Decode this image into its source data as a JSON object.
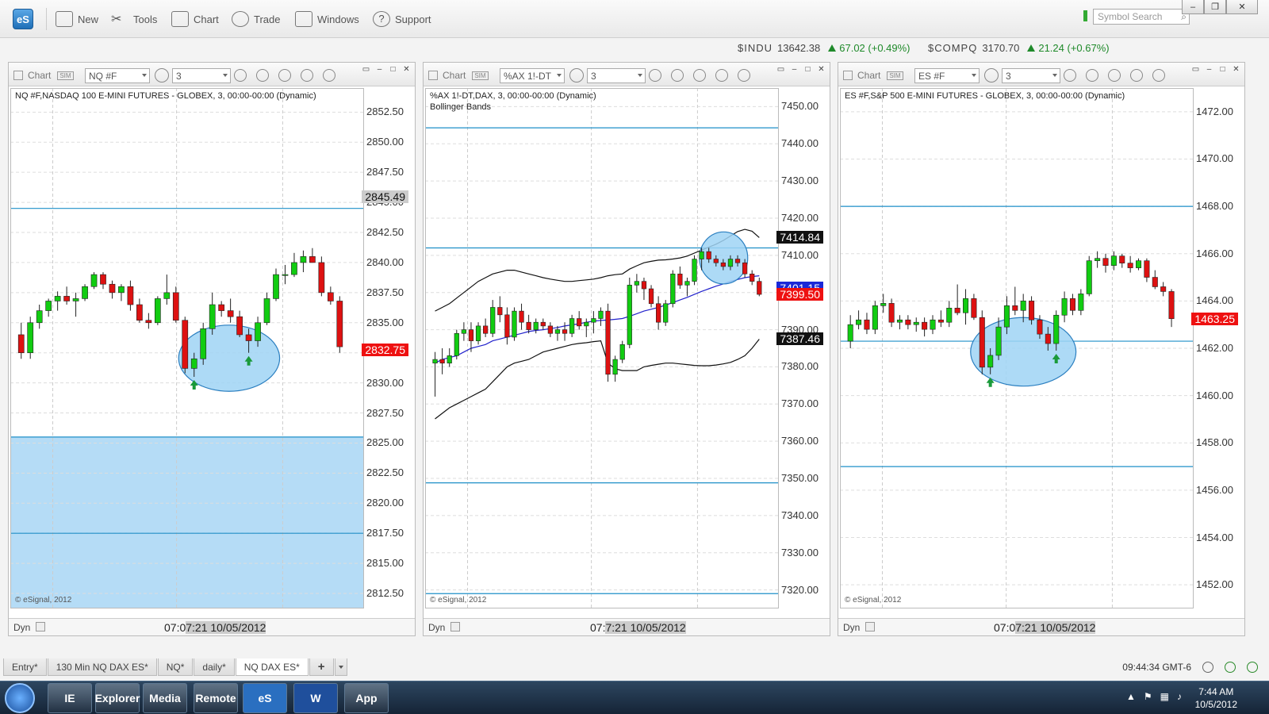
{
  "app": {
    "logo": "eS",
    "toolbar": [
      {
        "label": "New",
        "icon": "new-window-icon"
      },
      {
        "label": "Tools",
        "icon": "tools-icon"
      },
      {
        "label": "Chart",
        "icon": "chart-icon"
      },
      {
        "label": "Trade",
        "icon": "trade-icon"
      },
      {
        "label": "Windows",
        "icon": "windows-icon"
      },
      {
        "label": "Support",
        "icon": "help-icon"
      }
    ],
    "symbol_search_placeholder": "Symbol Search",
    "win_min": "–",
    "win_max": "❐",
    "win_close": "✕"
  },
  "ticker": [
    {
      "symbol": "$INDU",
      "value": "13642.38",
      "change": "67.02 (+0.49%)"
    },
    {
      "symbol": "$COMPQ",
      "value": "3170.70",
      "change": "21.24 (+0.67%)"
    }
  ],
  "panels": [
    {
      "title": "Chart",
      "symbol": "NQ #F",
      "interval": "3",
      "info": "NQ #F,NASDAQ 100 E-MINI FUTURES - GLOBEX, 3, 00:00-00:00 (Dynamic)",
      "info2": "",
      "copyright": "© eSignal, 2012",
      "dyn": "Dyn",
      "time_prefix": "07:0",
      "time_label": "7:21 10/05/2012",
      "ticks": [
        "2852.50",
        "2850.00",
        "2847.50",
        "2845.00",
        "2842.50",
        "2840.00",
        "2837.50",
        "2835.00",
        "2832.50",
        "2830.00",
        "2827.50",
        "2825.00",
        "2822.50",
        "2820.00",
        "2817.50",
        "2815.00",
        "2812.50"
      ],
      "price_tags": [
        {
          "label": "2845.49",
          "value": 2845.49,
          "style": "gray"
        },
        {
          "label": "2832.75",
          "value": 2832.75,
          "style": "red"
        }
      ]
    },
    {
      "title": "Chart",
      "symbol": "%AX 1!-DT",
      "interval": "3",
      "info": "%AX 1!-DT,DAX, 3, 00:00-00:00 (Dynamic)",
      "info2": "Bollinger Bands",
      "copyright": "© eSignal, 2012",
      "dyn": "Dyn",
      "time_prefix": "07:",
      "time_label": "7:21 10/05/2012",
      "ticks": [
        "7450.00",
        "7440.00",
        "7430.00",
        "7420.00",
        "7410.00",
        "7400.00",
        "7390.00",
        "7380.00",
        "7370.00",
        "7360.00",
        "7350.00",
        "7340.00",
        "7330.00",
        "7320.00"
      ],
      "price_tags": [
        {
          "label": "7414.84",
          "value": 7414.84,
          "style": "black"
        },
        {
          "label": "7401.15",
          "value": 7401.15,
          "style": "blue"
        },
        {
          "label": "7399.50",
          "value": 7399.5,
          "style": "red"
        },
        {
          "label": "7387.46",
          "value": 7387.46,
          "style": "black"
        }
      ]
    },
    {
      "title": "Chart",
      "symbol": "ES #F",
      "interval": "3",
      "info": "ES #F,S&P 500 E-MINI FUTURES - GLOBEX, 3, 00:00-00:00 (Dynamic)",
      "info2": "",
      "copyright": "© eSignal, 2012",
      "dyn": "Dyn",
      "time_prefix": "07:0",
      "time_label": "7:21 10/05/2012",
      "ticks": [
        "1472.00",
        "1470.00",
        "1468.00",
        "1466.00",
        "1464.00",
        "1462.00",
        "1460.00",
        "1458.00",
        "1456.00",
        "1454.00",
        "1452.00"
      ],
      "price_tags": [
        {
          "label": "1463.25",
          "value": 1463.25,
          "style": "red"
        }
      ]
    }
  ],
  "tabs": [
    {
      "label": "Entry*",
      "active": false
    },
    {
      "label": "130 Min NQ DAX ES*",
      "active": false
    },
    {
      "label": "NQ*",
      "active": false
    },
    {
      "label": "daily*",
      "active": false
    },
    {
      "label": "NQ DAX ES*",
      "active": true
    }
  ],
  "add_tab": "+",
  "status": {
    "time": "09:44:34 GMT-6"
  },
  "taskbar": {
    "clock_time": "7:44 AM",
    "clock_date": "10/5/2012",
    "apps": [
      "IE",
      "Explorer",
      "Media",
      "Remote",
      "eS",
      "W",
      "App"
    ]
  },
  "colors": {
    "bull": "#11cc11",
    "bear": "#dd1111",
    "level": "#1e8fc8",
    "zone": "#b5dcf6",
    "ellipse": "#9fd4f5"
  },
  "chart_data": [
    {
      "type": "candlestick",
      "symbol": "NQ #F",
      "ylim": [
        2811.25,
        2854.5
      ],
      "levels": [
        2844.5,
        2825.5,
        2817.5
      ],
      "zone": [
        2811.25,
        2825.5
      ],
      "last": 2832.75,
      "ohlc": [
        [
          2834,
          2835,
          2832,
          2832.5
        ],
        [
          2832.5,
          2835.5,
          2832,
          2835
        ],
        [
          2835,
          2836.5,
          2834.5,
          2836
        ],
        [
          2836,
          2837,
          2835.5,
          2836.8
        ],
        [
          2836.8,
          2837.6,
          2836,
          2837.2
        ],
        [
          2837.2,
          2838,
          2836.5,
          2836.8
        ],
        [
          2836.8,
          2837.5,
          2835.5,
          2837
        ],
        [
          2837,
          2838.2,
          2836.8,
          2838
        ],
        [
          2838,
          2839.2,
          2837.8,
          2839
        ],
        [
          2839,
          2839.2,
          2837.8,
          2838.2
        ],
        [
          2838.2,
          2838.5,
          2837,
          2837.5
        ],
        [
          2837.5,
          2838.2,
          2836.8,
          2838
        ],
        [
          2838,
          2838.5,
          2836,
          2836.5
        ],
        [
          2836.5,
          2837,
          2835,
          2835.2
        ],
        [
          2835.2,
          2835.8,
          2834.5,
          2835
        ],
        [
          2835,
          2837.2,
          2834.8,
          2837
        ],
        [
          2837,
          2839,
          2836.5,
          2837.5
        ],
        [
          2837.5,
          2838,
          2835,
          2835.2
        ],
        [
          2835.2,
          2835.5,
          2830.8,
          2831.2
        ],
        [
          2831.2,
          2832.5,
          2830.5,
          2832
        ],
        [
          2832,
          2835,
          2831.5,
          2834.5
        ],
        [
          2834.5,
          2837.5,
          2834,
          2836.5
        ],
        [
          2836.5,
          2836.8,
          2835.5,
          2836
        ],
        [
          2836,
          2837,
          2835,
          2835.5
        ],
        [
          2835.5,
          2836,
          2833.8,
          2834
        ],
        [
          2834,
          2834.5,
          2832.5,
          2833.5
        ],
        [
          2833.5,
          2835.5,
          2833,
          2835
        ],
        [
          2835,
          2837.5,
          2834.8,
          2837
        ],
        [
          2837,
          2839.5,
          2836.8,
          2839
        ],
        [
          2839,
          2839.8,
          2838.2,
          2839
        ],
        [
          2839,
          2840.8,
          2838.8,
          2840
        ],
        [
          2840,
          2841,
          2839.2,
          2840.5
        ],
        [
          2840.5,
          2841.2,
          2840,
          2840
        ],
        [
          2840,
          2840.5,
          2837.2,
          2837.5
        ],
        [
          2837.5,
          2838,
          2836.5,
          2836.8
        ],
        [
          2836.8,
          2837.2,
          2832.5,
          2833
        ]
      ],
      "arrows": [
        19,
        25
      ],
      "ellipse": {
        "i0": 17.3,
        "i1": 28.4,
        "y0": 2829.3,
        "y1": 2834.8
      }
    },
    {
      "type": "candlestick",
      "symbol": "%AX 1!-DT",
      "ylim": [
        7315,
        7455
      ],
      "levels": [
        7444.3,
        7412.0,
        7348.8,
        7319.0
      ],
      "last": 7399.5,
      "ohlc": [
        [
          7381,
          7384,
          7372,
          7382
        ],
        [
          7382,
          7385,
          7378,
          7381
        ],
        [
          7381,
          7385,
          7380,
          7383
        ],
        [
          7383,
          7390,
          7382,
          7389
        ],
        [
          7389,
          7392,
          7387,
          7390
        ],
        [
          7390,
          7392,
          7384,
          7387
        ],
        [
          7387,
          7392,
          7386,
          7391
        ],
        [
          7391,
          7393,
          7388,
          7389
        ],
        [
          7389,
          7398,
          7388,
          7396
        ],
        [
          7396,
          7399,
          7392,
          7394
        ],
        [
          7394,
          7396,
          7386,
          7388
        ],
        [
          7388,
          7396,
          7387,
          7395
        ],
        [
          7395,
          7397,
          7390,
          7392
        ],
        [
          7392,
          7394,
          7389,
          7390
        ],
        [
          7390,
          7393,
          7389,
          7392
        ],
        [
          7392,
          7393,
          7390,
          7391
        ],
        [
          7391,
          7392,
          7388,
          7389
        ],
        [
          7389,
          7391,
          7387,
          7390
        ],
        [
          7390,
          7392,
          7387,
          7389
        ],
        [
          7389,
          7394,
          7388,
          7393
        ],
        [
          7393,
          7395,
          7390,
          7391
        ],
        [
          7391,
          7393,
          7388,
          7392
        ],
        [
          7392,
          7395,
          7389,
          7393
        ],
        [
          7393,
          7396,
          7391,
          7395
        ],
        [
          7395,
          7397,
          7376,
          7378
        ],
        [
          7378,
          7383,
          7376,
          7382
        ],
        [
          7382,
          7387,
          7381,
          7386
        ],
        [
          7386,
          7404,
          7385,
          7402
        ],
        [
          7402,
          7405,
          7400,
          7403
        ],
        [
          7403,
          7404,
          7398,
          7401
        ],
        [
          7401,
          7402,
          7396,
          7397
        ],
        [
          7397,
          7399,
          7390,
          7392
        ],
        [
          7392,
          7398,
          7391,
          7397
        ],
        [
          7397,
          7406,
          7396,
          7405
        ],
        [
          7405,
          7407,
          7401,
          7402
        ],
        [
          7402,
          7404,
          7399,
          7403
        ],
        [
          7403,
          7410,
          7402,
          7409
        ],
        [
          7409,
          7412,
          7406,
          7411
        ],
        [
          7411,
          7412,
          7408,
          7409
        ],
        [
          7409,
          7410,
          7407,
          7408
        ],
        [
          7408,
          7409,
          7406,
          7407
        ],
        [
          7407,
          7410,
          7406,
          7409
        ],
        [
          7409,
          7410,
          7407,
          7408
        ],
        [
          7408,
          7409,
          7404,
          7405
        ],
        [
          7405,
          7406,
          7402,
          7403
        ],
        [
          7403,
          7404,
          7399,
          7399.5
        ]
      ],
      "bollinger": {
        "middle": [
          7381,
          7382,
          7382.5,
          7383,
          7384,
          7385,
          7385.5,
          7386,
          7387,
          7387.5,
          7388,
          7388.5,
          7389,
          7389.5,
          7389.8,
          7390,
          7390.3,
          7390.6,
          7391,
          7391.3,
          7391.6,
          7392,
          7392.3,
          7392.5,
          7392.6,
          7392.8,
          7393,
          7393.6,
          7394.3,
          7395,
          7395.5,
          7396,
          7396.6,
          7397.3,
          7398,
          7398.7,
          7399.5,
          7400.3,
          7401,
          7401.7,
          7402.3,
          7403,
          7403.5,
          7404,
          7404.3,
          7404.5
        ],
        "upper": [
          7395,
          7396,
          7397,
          7398.5,
          7400,
          7401.5,
          7403,
          7404,
          7405,
          7405.5,
          7406,
          7406,
          7405.5,
          7405,
          7404.5,
          7404,
          7403.6,
          7403.3,
          7403,
          7403,
          7403.2,
          7403.4,
          7403.6,
          7404,
          7404.5,
          7404.8,
          7405,
          7406.3,
          7407.2,
          7408,
          7408.4,
          7408.7,
          7408.8,
          7409,
          7409.3,
          7409.8,
          7410.6,
          7411.4,
          7412.2,
          7413,
          7414,
          7415.2,
          7416.4,
          7417,
          7416.5,
          7414.8
        ],
        "lower": [
          7366,
          7367.5,
          7369,
          7370,
          7371,
          7372,
          7373,
          7374,
          7376,
          7378,
          7380,
          7381,
          7381.5,
          7382,
          7383,
          7384,
          7384.5,
          7385,
          7385.5,
          7386,
          7386.3,
          7386.5,
          7386.8,
          7387,
          7381,
          7379.5,
          7379,
          7379,
          7379,
          7380,
          7380.4,
          7380.7,
          7381,
          7381,
          7380.8,
          7380.6,
          7380.4,
          7380.3,
          7380.3,
          7380.5,
          7380.8,
          7381.2,
          7382,
          7383,
          7385,
          7387.46
        ]
      },
      "ellipse": {
        "i0": 36.7,
        "i1": 43.4,
        "y0": 7402.3,
        "y1": 7416.3
      }
    },
    {
      "type": "candlestick",
      "symbol": "ES #F",
      "ylim": [
        1451.0,
        1473.0
      ],
      "levels": [
        1468.0,
        1462.3,
        1457.0
      ],
      "last": 1463.25,
      "ohlc": [
        [
          1462.3,
          1463.4,
          1462,
          1463
        ],
        [
          1463,
          1463.6,
          1462.8,
          1463.2
        ],
        [
          1463.2,
          1463.5,
          1462.6,
          1462.8
        ],
        [
          1462.8,
          1464,
          1462.6,
          1463.8
        ],
        [
          1463.8,
          1464.3,
          1463.5,
          1463.9
        ],
        [
          1463.9,
          1464.1,
          1462.9,
          1463.1
        ],
        [
          1463.1,
          1463.4,
          1462.8,
          1463.2
        ],
        [
          1463.2,
          1463.4,
          1462.8,
          1463
        ],
        [
          1463,
          1463.3,
          1462.7,
          1463.1
        ],
        [
          1463.1,
          1463.3,
          1462.5,
          1462.8
        ],
        [
          1462.8,
          1463.4,
          1462.6,
          1463.2
        ],
        [
          1463.2,
          1463.6,
          1462.9,
          1463.1
        ],
        [
          1463.1,
          1464,
          1462.9,
          1463.7
        ],
        [
          1463.7,
          1464.7,
          1463.4,
          1463.5
        ],
        [
          1463.5,
          1464.5,
          1463,
          1464.1
        ],
        [
          1464.1,
          1464.3,
          1463.2,
          1463.3
        ],
        [
          1463.3,
          1463.6,
          1460.9,
          1461.2
        ],
        [
          1461.2,
          1462,
          1460.9,
          1461.7
        ],
        [
          1461.7,
          1463.3,
          1461.5,
          1462.9
        ],
        [
          1462.9,
          1464.2,
          1462.6,
          1463.8
        ],
        [
          1463.8,
          1464.6,
          1463.4,
          1463.6
        ],
        [
          1463.6,
          1464.3,
          1463.1,
          1464
        ],
        [
          1464,
          1464.2,
          1463,
          1463.2
        ],
        [
          1463.2,
          1463.4,
          1462.4,
          1462.6
        ],
        [
          1462.6,
          1462.9,
          1461.9,
          1462.2
        ],
        [
          1462.2,
          1463.6,
          1461.9,
          1463.4
        ],
        [
          1463.4,
          1464.4,
          1463.1,
          1464.1
        ],
        [
          1464.1,
          1464.3,
          1463.4,
          1463.6
        ],
        [
          1463.6,
          1464.5,
          1463.4,
          1464.3
        ],
        [
          1464.3,
          1465.9,
          1464.2,
          1465.7
        ],
        [
          1465.7,
          1466.1,
          1465.4,
          1465.8
        ],
        [
          1465.8,
          1466,
          1465.2,
          1465.5
        ],
        [
          1465.5,
          1466.1,
          1465.3,
          1465.9
        ],
        [
          1465.9,
          1466,
          1465.4,
          1465.6
        ],
        [
          1465.6,
          1465.9,
          1465.2,
          1465.4
        ],
        [
          1465.4,
          1465.8,
          1465.3,
          1465.7
        ],
        [
          1465.7,
          1465.8,
          1464.8,
          1465
        ],
        [
          1465,
          1465.3,
          1464.5,
          1464.6
        ],
        [
          1464.6,
          1464.8,
          1464.2,
          1464.4
        ],
        [
          1464.4,
          1464.5,
          1462.9,
          1463.25
        ]
      ],
      "arrows": [
        17,
        25
      ],
      "ellipse": {
        "i0": 14.6,
        "i1": 27.4,
        "y0": 1460.4,
        "y1": 1463.3
      }
    }
  ]
}
